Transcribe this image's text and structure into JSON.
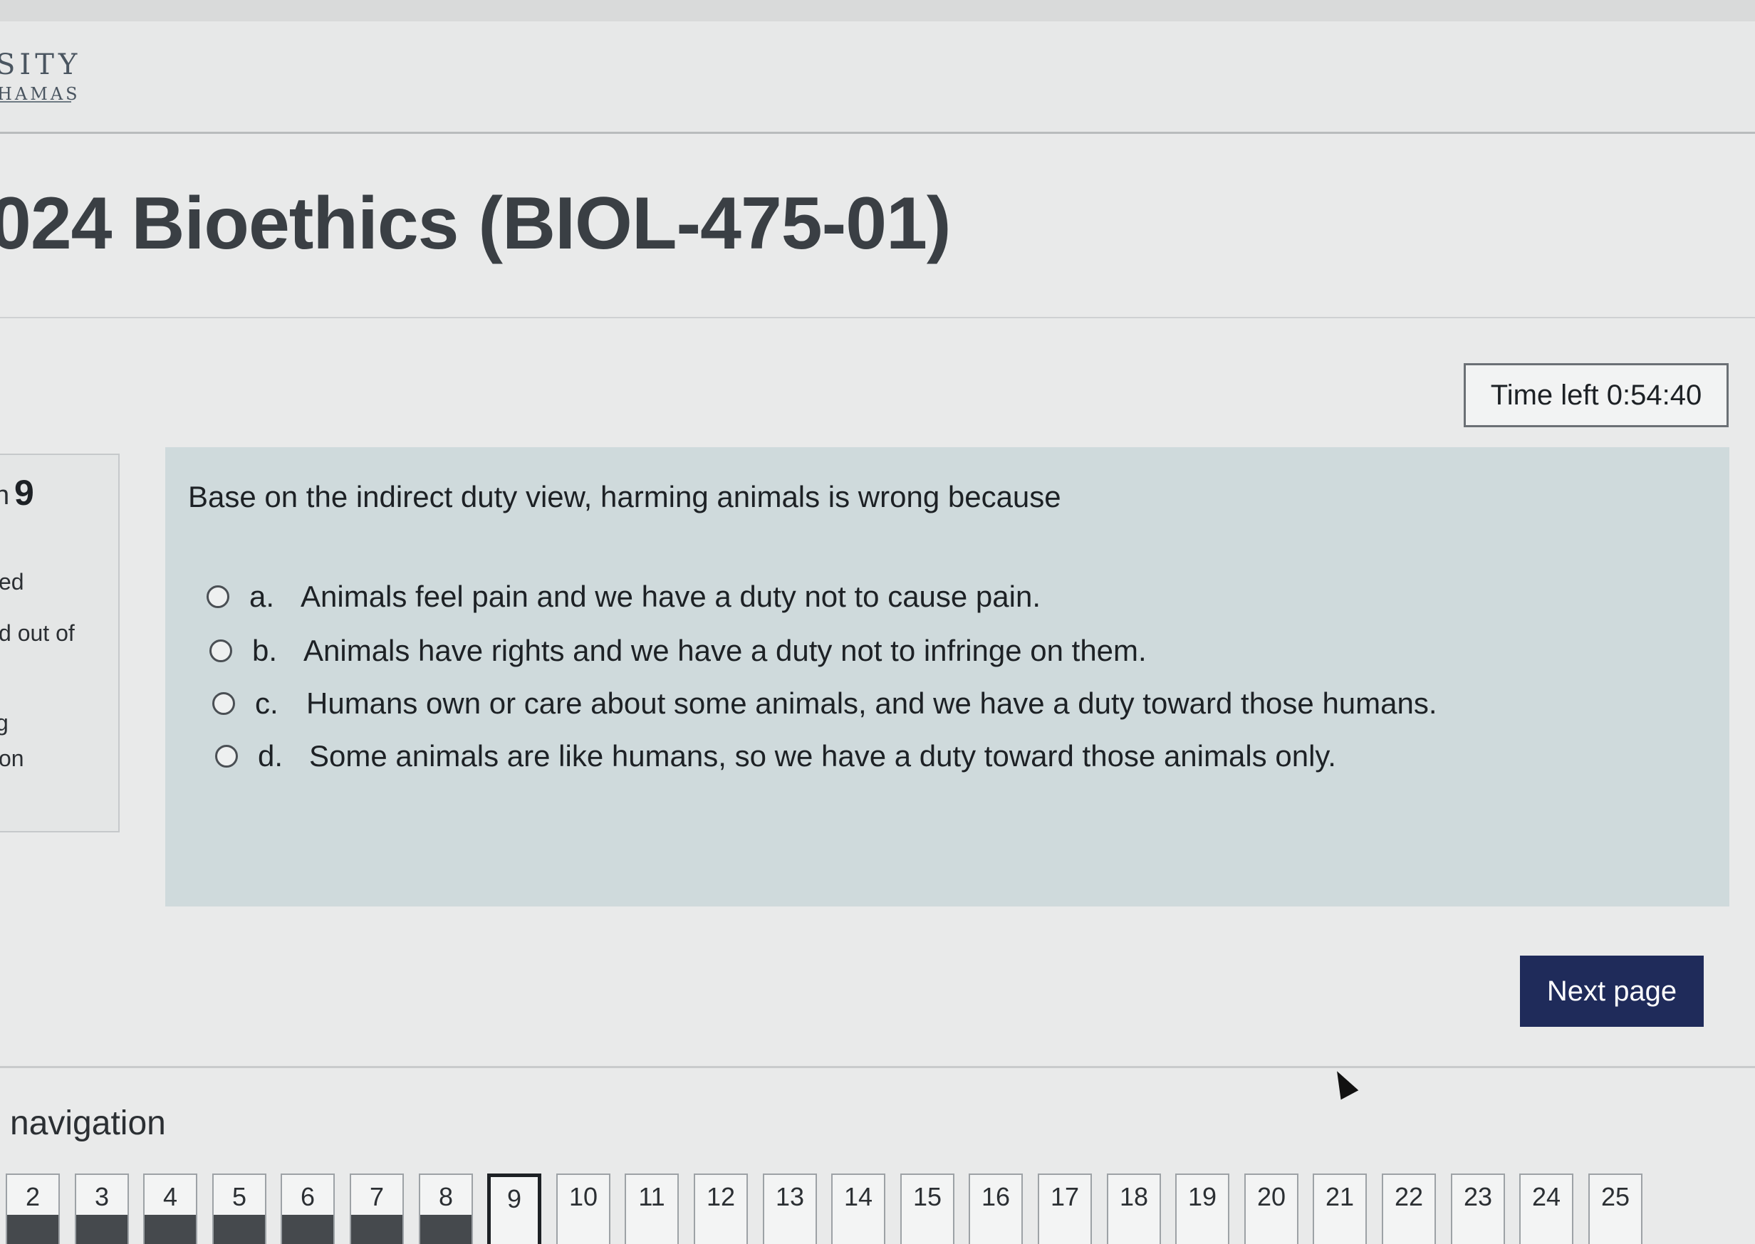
{
  "header": {
    "logo_line1": "SITY",
    "logo_line2": "HAMAS"
  },
  "course": {
    "title": "024 Bioethics (BIOL-475-01)"
  },
  "timer": {
    "label": "Time left 0:54:40"
  },
  "question_info": {
    "prefix": "n",
    "number": "9",
    "state": "ed",
    "marks": "d out of",
    "flag": "g",
    "text_link": "on"
  },
  "question": {
    "text": "Base on the indirect duty view, harming animals is wrong because",
    "answers": [
      {
        "letter": "a.",
        "text": "Animals feel pain and we have a duty not to cause pain."
      },
      {
        "letter": "b.",
        "text": "Animals have rights and we have a duty not to infringe on them."
      },
      {
        "letter": "c.",
        "text": "Humans own or care about some animals, and we have a duty toward those humans."
      },
      {
        "letter": "d.",
        "text": "Some animals are like humans, so we have a duty toward those animals only."
      }
    ]
  },
  "next_button": {
    "label": "Next page"
  },
  "navigation": {
    "heading": "navigation",
    "current": "9",
    "buttons": [
      {
        "label": "2",
        "answered": true
      },
      {
        "label": "3",
        "answered": true
      },
      {
        "label": "4",
        "answered": true
      },
      {
        "label": "5",
        "answered": true
      },
      {
        "label": "6",
        "answered": true
      },
      {
        "label": "7",
        "answered": true
      },
      {
        "label": "8",
        "answered": true
      },
      {
        "label": "9",
        "answered": false
      },
      {
        "label": "10",
        "answered": false
      },
      {
        "label": "11",
        "answered": false
      },
      {
        "label": "12",
        "answered": false
      },
      {
        "label": "13",
        "answered": false
      },
      {
        "label": "14",
        "answered": false
      },
      {
        "label": "15",
        "answered": false
      },
      {
        "label": "16",
        "answered": false
      },
      {
        "label": "17",
        "answered": false
      },
      {
        "label": "18",
        "answered": false
      },
      {
        "label": "19",
        "answered": false
      },
      {
        "label": "20",
        "answered": false
      },
      {
        "label": "21",
        "answered": false
      },
      {
        "label": "22",
        "answered": false
      },
      {
        "label": "23",
        "answered": false
      },
      {
        "label": "24",
        "answered": false
      },
      {
        "label": "25",
        "answered": false
      }
    ]
  }
}
